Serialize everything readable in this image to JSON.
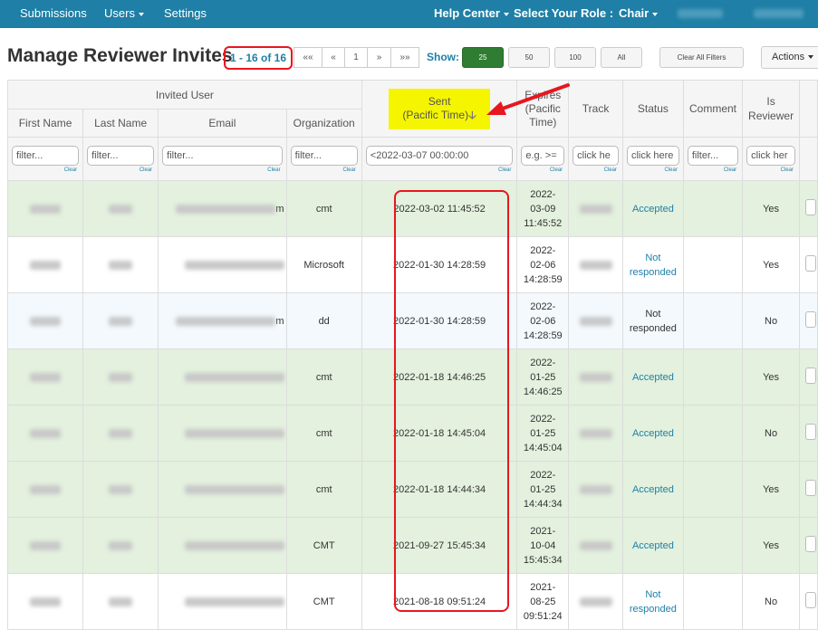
{
  "navbar": {
    "submissions": "Submissions",
    "users": "Users",
    "settings": "Settings",
    "help_center": "Help Center",
    "select_role_label": "Select Your Role :",
    "role": "Chair"
  },
  "header": {
    "title": "Manage Reviewer Invites",
    "count": "1 - 16 of 16",
    "pager": {
      "first": "««",
      "prev": "«",
      "page": "1",
      "next": "»",
      "last": "»»"
    },
    "show_label": "Show:",
    "show_options": [
      "25",
      "50",
      "100",
      "All"
    ],
    "clear_filters": "Clear All Filters",
    "actions": "Actions"
  },
  "table": {
    "group_header": "Invited User",
    "columns": {
      "first_name": "First Name",
      "last_name": "Last Name",
      "email": "Email",
      "organization": "Organization",
      "sent": "Sent",
      "sent_sub": "(Pacific Time)",
      "expires": "Expires",
      "expires_sub1": "(Pacific",
      "expires_sub2": "Time)",
      "track": "Track",
      "status": "Status",
      "comment": "Comment",
      "is_reviewer_1": "Is",
      "is_reviewer_2": "Reviewer"
    },
    "filters": {
      "first_name": "filter...",
      "last_name": "filter...",
      "email": "filter...",
      "organization": "filter...",
      "sent": "<2022-03-07 00:00:00",
      "expires": "e.g. >=",
      "track": "click he",
      "status": "click here",
      "comment": "filter...",
      "is_reviewer": "click her",
      "clear": "Clear"
    },
    "rows": [
      {
        "email_tail": "m",
        "org": "cmt",
        "sent": "2022-03-02 11:45:52",
        "exp_y": "2022-",
        "exp_md": "03-09",
        "exp_t": "11:45:52",
        "status1": "Accepted",
        "status2": "",
        "status_color": "accepted",
        "reviewer": "Yes",
        "color": "green"
      },
      {
        "email_tail": "",
        "org": "Microsoft",
        "sent": "2022-01-30 14:28:59",
        "exp_y": "2022-",
        "exp_md": "02-06",
        "exp_t": "14:28:59",
        "status1": "Not",
        "status2": "responded",
        "status_color": "blue",
        "reviewer": "Yes",
        "color": "white"
      },
      {
        "email_tail": "m",
        "org": "dd",
        "sent": "2022-01-30 14:28:59",
        "exp_y": "2022-",
        "exp_md": "02-06",
        "exp_t": "14:28:59",
        "status1": "Not",
        "status2": "responded",
        "status_color": "dark",
        "reviewer": "No",
        "color": "lightblue"
      },
      {
        "email_tail": "",
        "org": "cmt",
        "sent": "2022-01-18 14:46:25",
        "exp_y": "2022-",
        "exp_md": "01-25",
        "exp_t": "14:46:25",
        "status1": "Accepted",
        "status2": "",
        "status_color": "accepted",
        "reviewer": "Yes",
        "color": "green"
      },
      {
        "email_tail": "",
        "org": "cmt",
        "sent": "2022-01-18 14:45:04",
        "exp_y": "2022-",
        "exp_md": "01-25",
        "exp_t": "14:45:04",
        "status1": "Accepted",
        "status2": "",
        "status_color": "accepted",
        "reviewer": "No",
        "color": "green"
      },
      {
        "email_tail": "",
        "org": "cmt",
        "sent": "2022-01-18 14:44:34",
        "exp_y": "2022-",
        "exp_md": "01-25",
        "exp_t": "14:44:34",
        "status1": "Accepted",
        "status2": "",
        "status_color": "accepted",
        "reviewer": "Yes",
        "color": "green"
      },
      {
        "email_tail": "",
        "org": "CMT",
        "sent": "2021-09-27 15:45:34",
        "exp_y": "2021-",
        "exp_md": "10-04",
        "exp_t": "15:45:34",
        "status1": "Accepted",
        "status2": "",
        "status_color": "accepted",
        "reviewer": "Yes",
        "color": "green"
      },
      {
        "email_tail": "",
        "org": "CMT",
        "sent": "2021-08-18 09:51:24",
        "exp_y": "2021-",
        "exp_md": "08-25",
        "exp_t": "09:51:24",
        "status1": "Not",
        "status2": "responded",
        "status_color": "blue",
        "reviewer": "No",
        "color": "white"
      }
    ]
  },
  "colors": {
    "navbar": "#1f7fa6",
    "accent_red": "#e8161f",
    "highlight": "#f5f500",
    "accepted_row": "#e3f1de",
    "active_btn": "#2e7d32"
  }
}
